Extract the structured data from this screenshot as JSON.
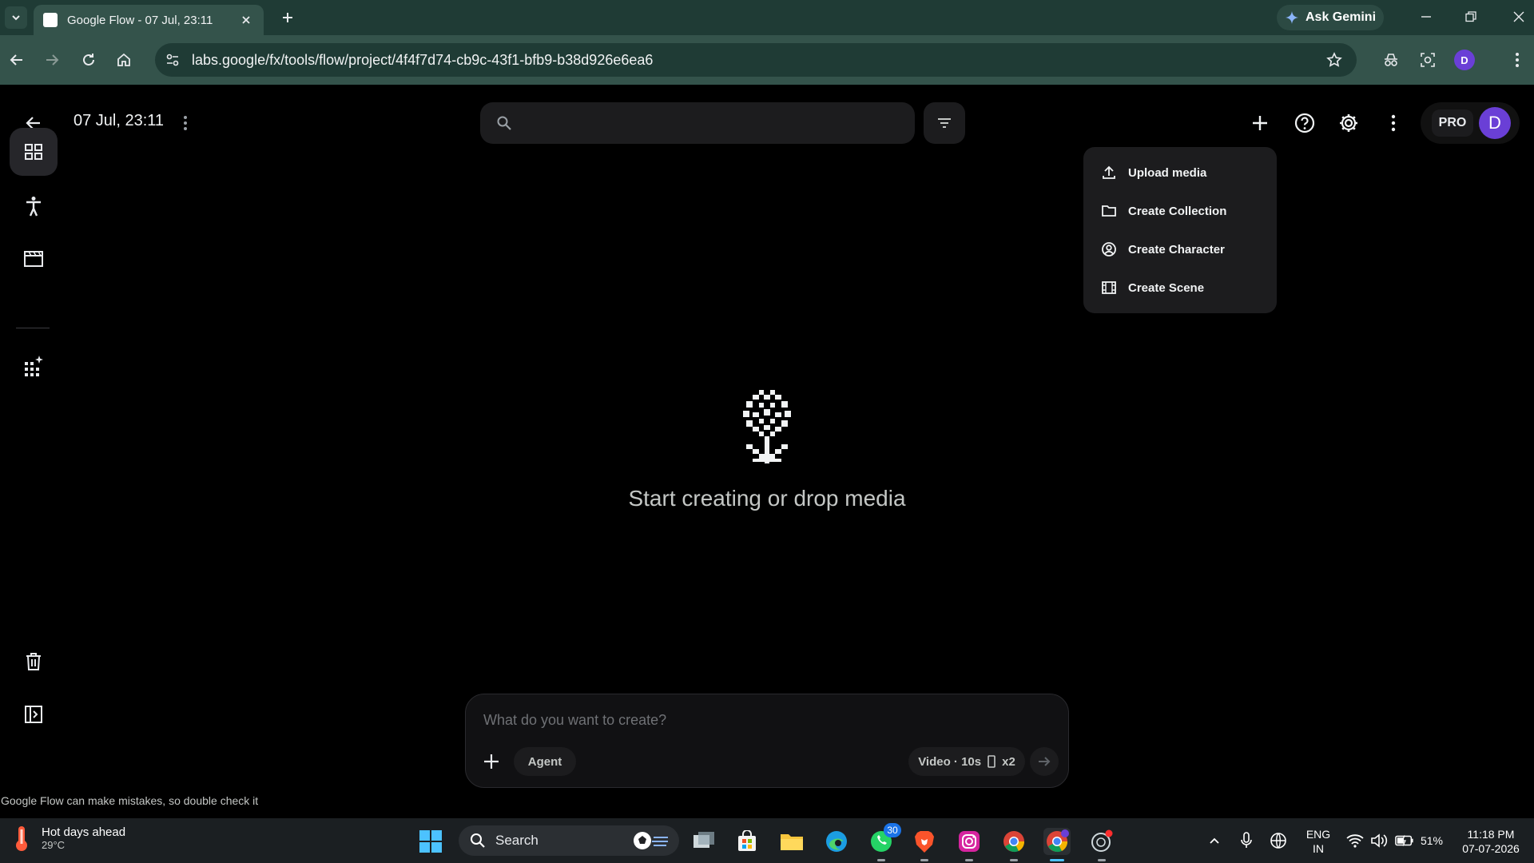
{
  "browser": {
    "tab_title": "Google Flow - 07 Jul, 23:11",
    "ask_gemini": "Ask Gemini",
    "url": "labs.google/fx/tools/flow/project/4f4f7d74-cb9c-43f1-bfb9-b38d926e6ea6",
    "profile_initial": "D"
  },
  "header": {
    "project_title": "07 Jul, 23:11",
    "search_placeholder": "",
    "pro_label": "PRO",
    "avatar_initial": "D"
  },
  "add_menu": {
    "items": [
      {
        "label": "Upload media",
        "icon": "upload-icon"
      },
      {
        "label": "Create Collection",
        "icon": "folder-icon"
      },
      {
        "label": "Create Character",
        "icon": "character-icon"
      },
      {
        "label": "Create Scene",
        "icon": "scene-icon"
      }
    ]
  },
  "sidebar": {
    "items": [
      {
        "name": "grid-view",
        "icon": "grid-icon",
        "active": true
      },
      {
        "name": "characters",
        "icon": "person-icon"
      },
      {
        "name": "scenes",
        "icon": "clapperboard-icon"
      },
      {
        "name": "tools",
        "icon": "sparkle-grid-icon"
      },
      {
        "name": "trash",
        "icon": "trash-icon"
      },
      {
        "name": "panel",
        "icon": "panel-icon"
      }
    ]
  },
  "empty_state": {
    "text": "Start creating or drop media"
  },
  "prompt": {
    "placeholder": "What do you want to create?",
    "agent_label": "Agent",
    "settings_label": "Video · 10s",
    "count_label": "x2"
  },
  "disclaimer": "Google Flow can make mistakes, so double check it",
  "taskbar": {
    "weather_title": "Hot days ahead",
    "weather_temp": "29°C",
    "search_label": "Search",
    "whatsapp_badge": "30",
    "lang_line1": "ENG",
    "lang_line2": "IN",
    "battery": "51%",
    "time": "11:18 PM",
    "date": "07-07-2026"
  },
  "colors": {
    "accent_avatar": "#6a3fd6",
    "chrome_dark": "#1f3b35",
    "chrome_light": "#34534b"
  }
}
